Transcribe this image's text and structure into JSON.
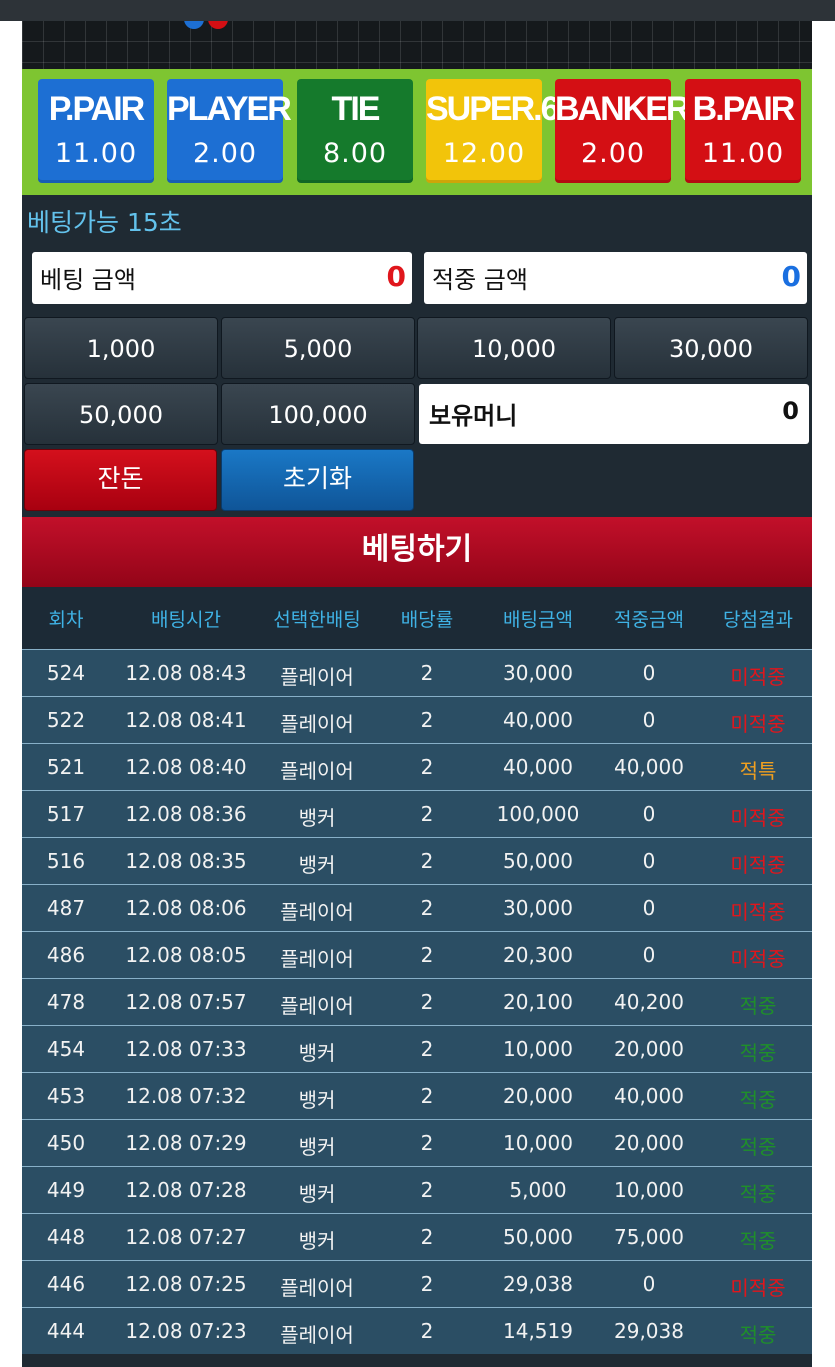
{
  "odds": [
    {
      "name": "P.PAIR",
      "value": "11.00",
      "color": "#1d6fd3"
    },
    {
      "name": "PLAYER",
      "value": "2.00",
      "color": "#1d6fd3"
    },
    {
      "name": "TIE",
      "value": "8.00",
      "color": "#157a2c"
    },
    {
      "name": "SUPER.6",
      "value": "12.00",
      "color": "#f2c40a"
    },
    {
      "name": "BANKER",
      "value": "2.00",
      "color": "#d40f14"
    },
    {
      "name": "B.PAIR",
      "value": "11.00",
      "color": "#d40f14"
    }
  ],
  "timer_text": "베팅가능 15초",
  "bet_amount": {
    "label": "베팅 금액",
    "value": "0"
  },
  "hit_amount": {
    "label": "적중 금액",
    "value": "0"
  },
  "chips": [
    "1,000",
    "5,000",
    "10,000",
    "30,000",
    "50,000",
    "100,000"
  ],
  "holding_money": {
    "label": "보유머니",
    "value": "0"
  },
  "buttons": {
    "change": "잔돈",
    "reset": "초기화",
    "bet": "베팅하기"
  },
  "table": {
    "headers": [
      "회차",
      "배팅시간",
      "선택한배팅",
      "배당률",
      "배팅금액",
      "적중금액",
      "당첨결과"
    ],
    "rows": [
      [
        "524",
        "12.08 08:43",
        "플레이어",
        "2",
        "30,000",
        "0",
        "미적중"
      ],
      [
        "522",
        "12.08 08:41",
        "플레이어",
        "2",
        "40,000",
        "0",
        "미적중"
      ],
      [
        "521",
        "12.08 08:40",
        "플레이어",
        "2",
        "40,000",
        "40,000",
        "적특"
      ],
      [
        "517",
        "12.08 08:36",
        "뱅커",
        "2",
        "100,000",
        "0",
        "미적중"
      ],
      [
        "516",
        "12.08 08:35",
        "뱅커",
        "2",
        "50,000",
        "0",
        "미적중"
      ],
      [
        "487",
        "12.08 08:06",
        "플레이어",
        "2",
        "30,000",
        "0",
        "미적중"
      ],
      [
        "486",
        "12.08 08:05",
        "플레이어",
        "2",
        "20,300",
        "0",
        "미적중"
      ],
      [
        "478",
        "12.08 07:57",
        "플레이어",
        "2",
        "20,100",
        "40,200",
        "적중"
      ],
      [
        "454",
        "12.08 07:33",
        "뱅커",
        "2",
        "10,000",
        "20,000",
        "적중"
      ],
      [
        "453",
        "12.08 07:32",
        "뱅커",
        "2",
        "20,000",
        "40,000",
        "적중"
      ],
      [
        "450",
        "12.08 07:29",
        "뱅커",
        "2",
        "10,000",
        "20,000",
        "적중"
      ],
      [
        "449",
        "12.08 07:28",
        "뱅커",
        "2",
        "5,000",
        "10,000",
        "적중"
      ],
      [
        "448",
        "12.08 07:27",
        "뱅커",
        "2",
        "50,000",
        "75,000",
        "적중"
      ],
      [
        "446",
        "12.08 07:25",
        "플레이어",
        "2",
        "29,038",
        "0",
        "미적중"
      ],
      [
        "444",
        "12.08 07:23",
        "플레이어",
        "2",
        "14,519",
        "29,038",
        "적중"
      ]
    ]
  },
  "result_colors": {
    "미적중": "#e0161c",
    "적특": "#f0a020",
    "적중": "#1f8f2a"
  }
}
